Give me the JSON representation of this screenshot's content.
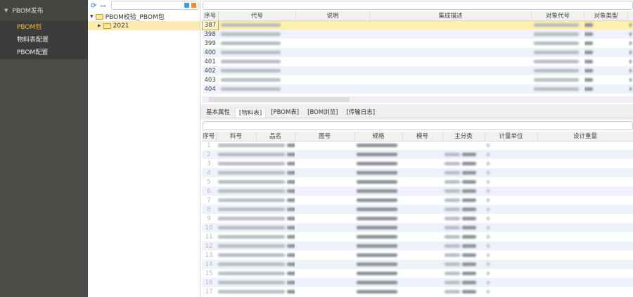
{
  "sidebar": {
    "group": "PBOM发布",
    "items": [
      {
        "label": "PBOM包",
        "active": true
      },
      {
        "label": "物料表配置"
      },
      {
        "label": "PBOM配置"
      }
    ]
  },
  "tree": {
    "root": "PBOM校验_PBOM包",
    "child": "2021"
  },
  "upper_table": {
    "columns": [
      "序号",
      "代号",
      "说明",
      "集成描述",
      "对象代号",
      "对象类型"
    ],
    "rows": [
      "387",
      "398",
      "399",
      "400",
      "401",
      "402",
      "403",
      "404"
    ],
    "selected": "387"
  },
  "tabs": [
    {
      "label": "基本属性"
    },
    {
      "label": "[物料表]",
      "active": true
    },
    {
      "label": "[PBOM表]"
    },
    {
      "label": "[BOM浏览]"
    },
    {
      "label": "[传输日志]"
    }
  ],
  "lower_table": {
    "columns": [
      "序号",
      "料号",
      "品名",
      "图号",
      "规格",
      "模号",
      "主分类",
      "计量单位",
      "设计重量"
    ],
    "rows": [
      "1",
      "2",
      "3",
      "4",
      "5",
      "6",
      "7",
      "8",
      "9",
      "10",
      "11",
      "12",
      "13",
      "14",
      "15",
      "16",
      "17"
    ]
  },
  "colors": {
    "sidebar": "#4b4c48",
    "active": "#f2b53c",
    "selected_row": "#fdf0a8",
    "alt_row": "#eef2fb"
  }
}
